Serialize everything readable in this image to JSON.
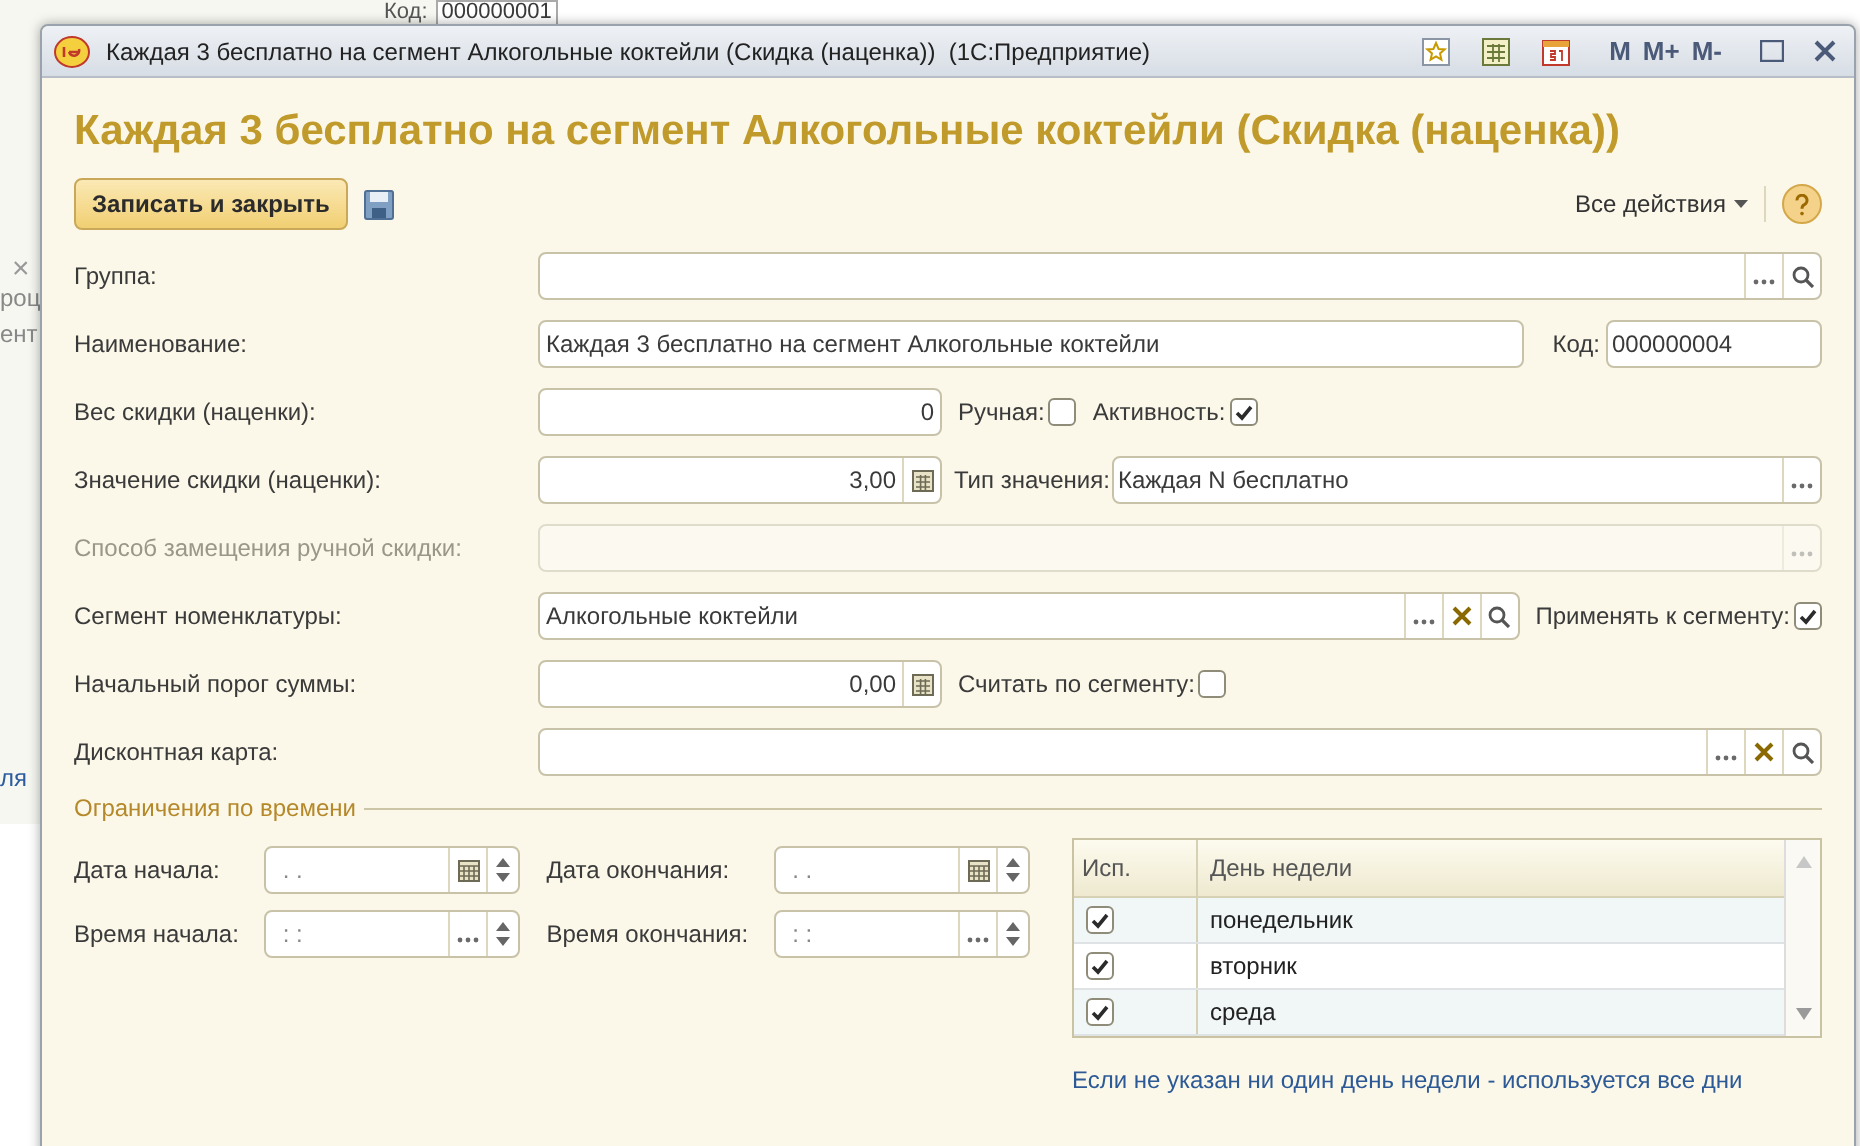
{
  "background_window": {
    "code_label": "Код:",
    "code_value": "000000001",
    "fragments": [
      {
        "kind": "close",
        "text": "×"
      },
      {
        "kind": "text",
        "text": "роц"
      },
      {
        "kind": "text",
        "text": "ент"
      },
      {
        "kind": "link",
        "text": "ля"
      }
    ]
  },
  "window": {
    "title": "Каждая 3 бесплатно на сегмент Алкогольные коктейли (Скидка (наценка))  (1С:Предприятие)",
    "memory_buttons": [
      "M",
      "M+",
      "M-"
    ]
  },
  "form": {
    "heading": "Каждая 3 бесплатно на сегмент Алкогольные коктейли (Скидка (наценка))",
    "save_button": "Записать и закрыть",
    "all_actions": "Все действия"
  },
  "rows": [
    {
      "label": "Группа:",
      "disabled": false,
      "field": {
        "kind": "text",
        "choose": true,
        "search": true
      }
    },
    {
      "label": "Наименование:",
      "disabled": false,
      "field": {
        "kind": "text",
        "value": "Каждая 3 бесплатно на сегмент Алкогольные коктейли"
      },
      "extras": [
        {
          "kind": "code",
          "label": "Код:",
          "value": "000000004"
        }
      ]
    },
    {
      "label": "Вес скидки (наценки):",
      "disabled": false,
      "field": {
        "kind": "number",
        "value": "0"
      },
      "extras": [
        {
          "kind": "checkbox",
          "label": "Ручная:",
          "checked": false
        },
        {
          "kind": "checkbox",
          "label": "Активность:",
          "checked": true
        }
      ]
    },
    {
      "label": "Значение скидки (наценки):",
      "disabled": false,
      "field": {
        "kind": "number",
        "value": "3,00",
        "calculator": true
      },
      "extras": [
        {
          "kind": "select",
          "label": "Тип значения:",
          "value": "Каждая N бесплатно"
        }
      ]
    },
    {
      "label": "Способ замещения ручной скидки:",
      "disabled": true,
      "field": {
        "kind": "text",
        "choose": true
      }
    },
    {
      "label": "Сегмент номенклатуры:",
      "disabled": false,
      "field": {
        "kind": "text",
        "value": "Алкогольные коктейли",
        "choose": true,
        "clear": true,
        "search": true
      },
      "extras": [
        {
          "kind": "checkbox",
          "label": "Применять к сегменту:",
          "checked": true
        }
      ]
    },
    {
      "label": "Начальный порог суммы:",
      "disabled": false,
      "field": {
        "kind": "number",
        "value": "0,00",
        "calculator": true
      },
      "extras": [
        {
          "kind": "checkbox",
          "label": "Считать по сегменту:",
          "checked": false
        }
      ]
    },
    {
      "label": "Дисконтная карта:",
      "disabled": false,
      "field": {
        "kind": "text",
        "choose": true,
        "clear": true,
        "search": true
      }
    }
  ],
  "time_limits": {
    "legend": "Ограничения по времени",
    "fields": [
      {
        "label": "Дата начала:",
        "placeholder": ". .",
        "calendar": true
      },
      {
        "label": "Дата окончания:",
        "placeholder": ". .",
        "calendar": true
      },
      {
        "label": "Время начала:",
        "placeholder": ": :",
        "choose": true
      },
      {
        "label": "Время окончания:",
        "placeholder": ": :",
        "choose": true
      }
    ],
    "table": {
      "columns": [
        "Исп.",
        "День недели"
      ],
      "rows": [
        {
          "checked": true,
          "day": "понедельник"
        },
        {
          "checked": true,
          "day": "вторник"
        },
        {
          "checked": true,
          "day": "среда"
        }
      ]
    },
    "note": "Если не указан ни один день недели - используется все дни"
  }
}
